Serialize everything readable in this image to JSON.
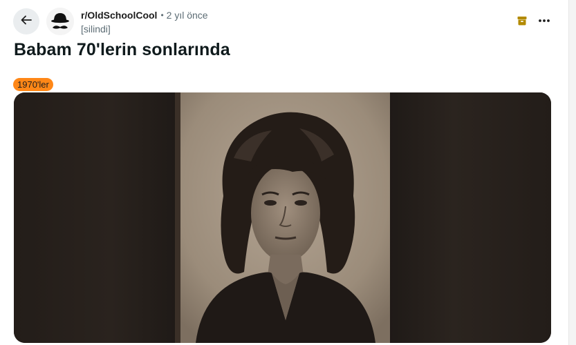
{
  "header": {
    "back_icon": "arrow-left-icon",
    "subreddit": "r/OldSchoolCool",
    "separator": "•",
    "time_ago": "2 yıl önce",
    "author": "[silindi]",
    "archive_icon": "archive-icon",
    "more_icon": "ellipsis-icon"
  },
  "post": {
    "title": "Babam 70'lerin sonlarında",
    "flair": "1970'ler"
  },
  "colors": {
    "flair_bg": "#ff8717",
    "archive_icon": "#b38a00",
    "back_button_bg": "#eaedef"
  }
}
